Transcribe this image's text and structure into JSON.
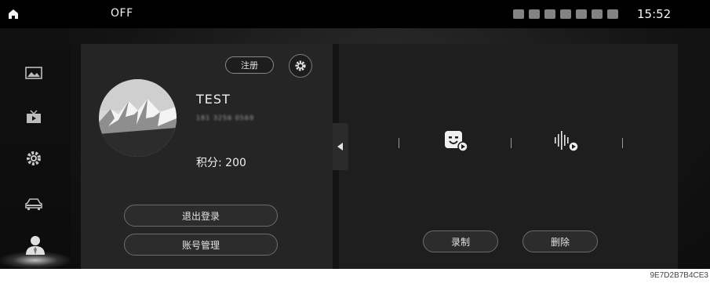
{
  "statusbar": {
    "power_state": "OFF",
    "time": "15:52"
  },
  "sidebar": {
    "items": [
      {
        "icon": "gallery-icon"
      },
      {
        "icon": "tv-icon"
      },
      {
        "icon": "gear-icon"
      },
      {
        "icon": "car-icon"
      },
      {
        "icon": "user-icon",
        "active": true
      }
    ]
  },
  "profile": {
    "register_label": "注册",
    "username": "TEST",
    "phone_masked": "181 3256 0569",
    "points_label": "积分: 200",
    "logout_label": "退出登录",
    "account_label": "账号管理"
  },
  "voice": {
    "record_label": "录制",
    "delete_label": "删除"
  },
  "watermark": "9E7D2B7B4CE3",
  "colors": {
    "accent": "#ffffff",
    "panel": "#252525",
    "background": "#0f0f0f"
  }
}
